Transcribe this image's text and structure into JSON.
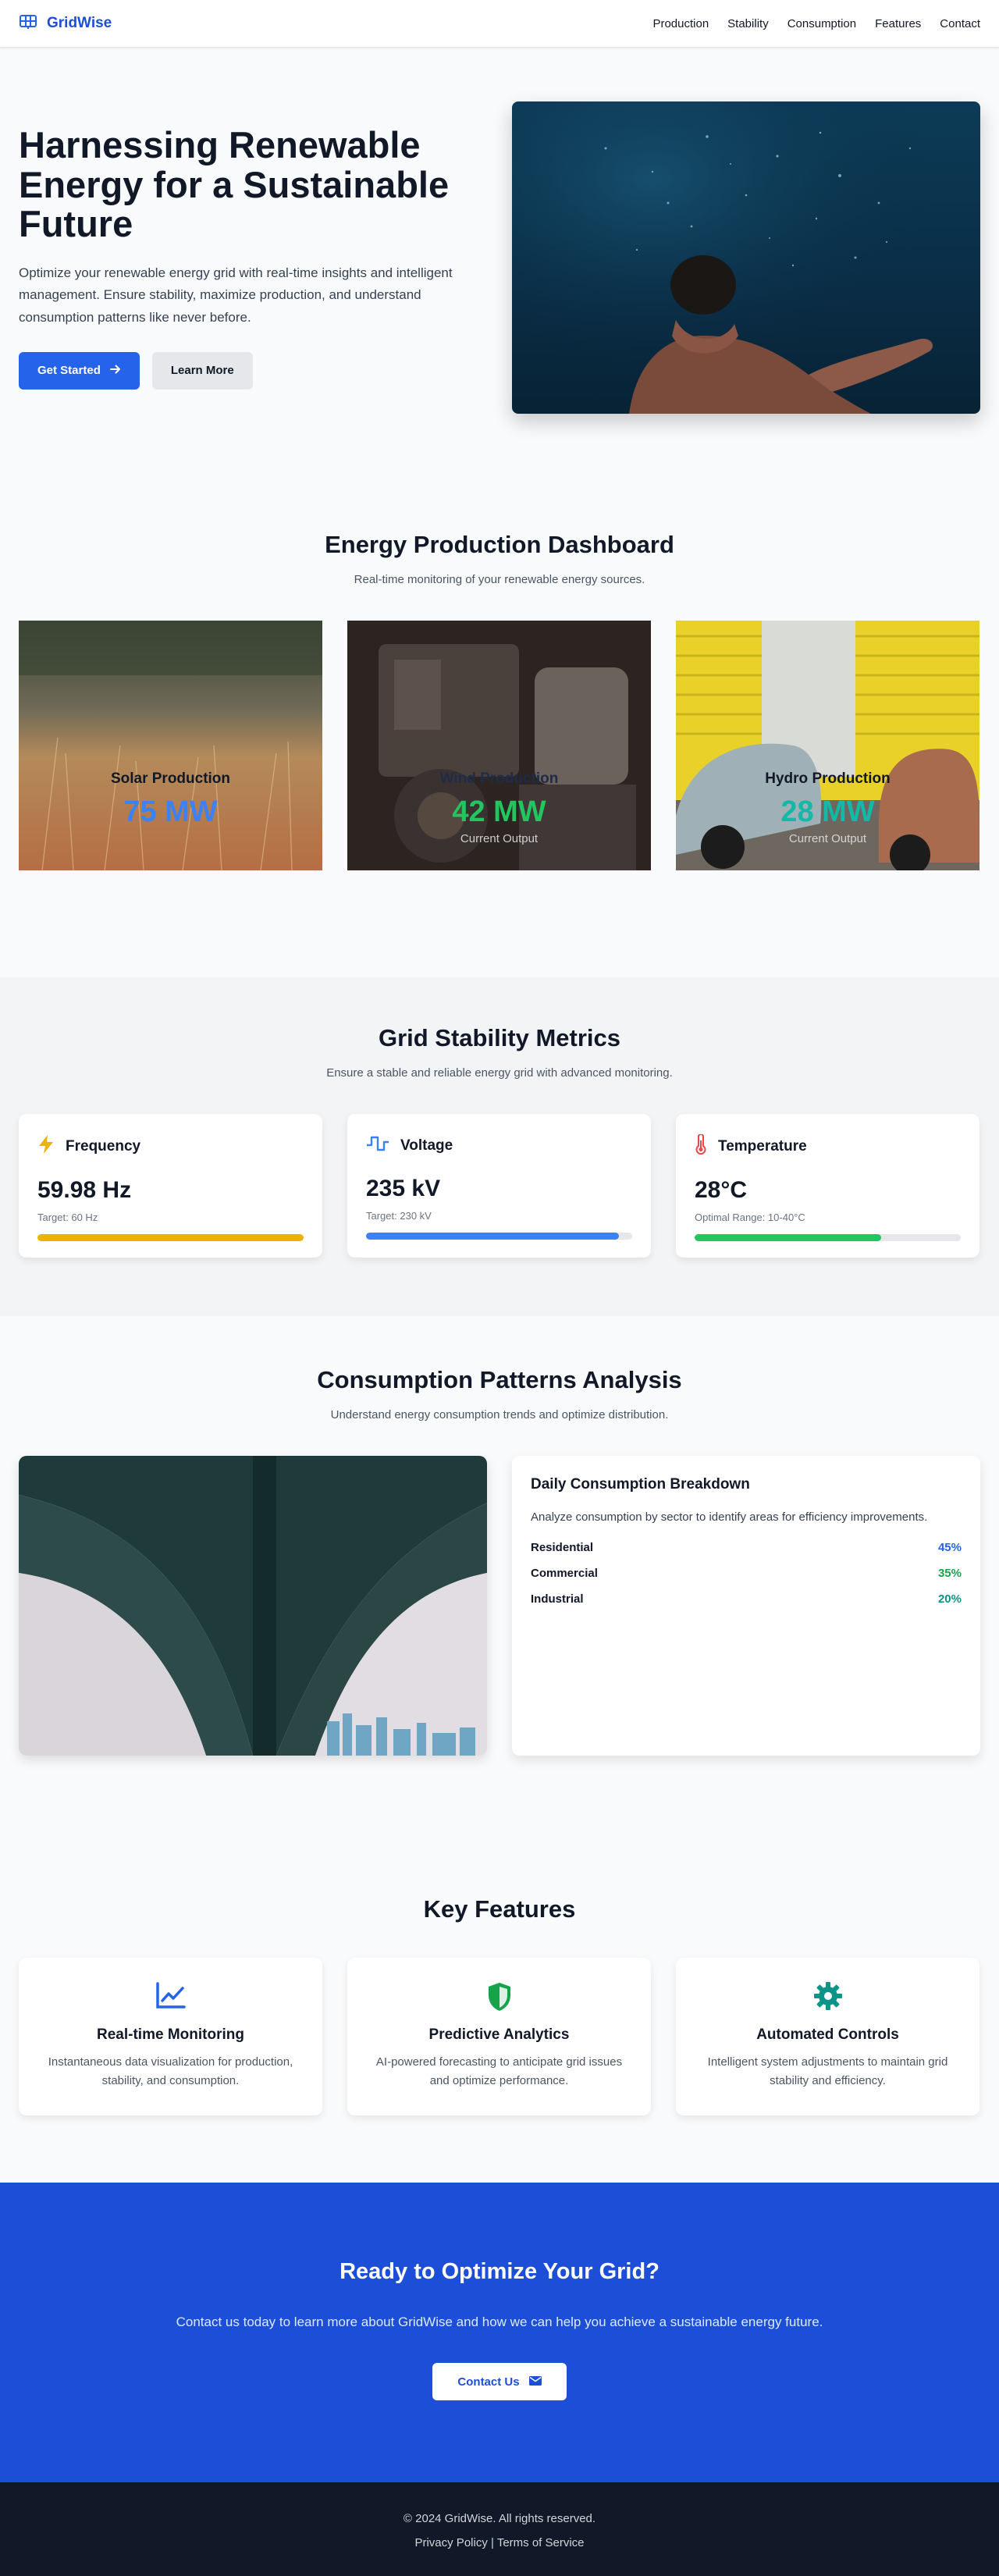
{
  "header": {
    "brand": "GridWise",
    "nav": [
      "Production",
      "Stability",
      "Consumption",
      "Features",
      "Contact"
    ]
  },
  "hero": {
    "title": "Harnessing Renewable Energy for a Sustainable Future",
    "subtitle": "Optimize your renewable energy grid with real-time insights and intelligent management. Ensure stability, maximize production, and understand consumption patterns like never before.",
    "primary_button": "Get Started",
    "secondary_button": "Learn More"
  },
  "dashboard": {
    "title": "Energy Production Dashboard",
    "subtitle": "Real-time monitoring of your renewable energy sources.",
    "cards": [
      {
        "name": "Solar Production",
        "value": "75 MW",
        "label": "",
        "value_color": "#3b82f6"
      },
      {
        "name": "Wind Production",
        "value": "42 MW",
        "label": "Current Output",
        "value_color": "#22c55e"
      },
      {
        "name": "Hydro Production",
        "value": "28 MW",
        "label": "Current Output",
        "value_color": "#14b8a6"
      }
    ]
  },
  "stability": {
    "title": "Grid Stability Metrics",
    "subtitle": "Ensure a stable and reliable energy grid with advanced monitoring.",
    "cards": [
      {
        "name": "Frequency",
        "icon": "lightning-icon",
        "value": "59.98 Hz",
        "target": "Target: 60 Hz",
        "fill_fraction": 1.0,
        "color": "#eab308"
      },
      {
        "name": "Voltage",
        "icon": "pulse-icon",
        "value": "235 kV",
        "target": "Target: 230 kV",
        "fill_fraction": 0.95,
        "color": "#3b82f6"
      },
      {
        "name": "Temperature",
        "icon": "thermometer-icon",
        "value": "28°C",
        "target": "Optimal Range: 10-40°C",
        "fill_fraction": 0.7,
        "color": "#22c55e"
      }
    ]
  },
  "consumption": {
    "title": "Consumption Patterns Analysis",
    "subtitle": "Understand energy consumption trends and optimize distribution.",
    "card_title": "Daily Consumption Breakdown",
    "card_desc": "Analyze consumption by sector to identify areas for efficiency improvements.",
    "rows": [
      {
        "sector": "Residential",
        "share": "45%",
        "color": "#2563eb"
      },
      {
        "sector": "Commercial",
        "share": "35%",
        "color": "#16a34a"
      },
      {
        "sector": "Industrial",
        "share": "20%",
        "color": "#0d9488"
      }
    ]
  },
  "features": {
    "title": "Key Features",
    "items": [
      {
        "icon": "chart-line-icon",
        "title": "Real-time Monitoring",
        "desc": "Instantaneous data visualization for production, stability, and consumption.",
        "color": "#2563eb"
      },
      {
        "icon": "shield-icon",
        "title": "Predictive Analytics",
        "desc": "AI-powered forecasting to anticipate grid issues and optimize performance.",
        "color": "#16a34a"
      },
      {
        "icon": "gear-icon",
        "title": "Automated Controls",
        "desc": "Intelligent system adjustments to maintain grid stability and efficiency.",
        "color": "#0d9488"
      }
    ]
  },
  "cta": {
    "title": "Ready to Optimize Your Grid?",
    "subtitle": "Contact us today to learn more about GridWise and how we can help you achieve a sustainable energy future.",
    "button": "Contact Us"
  },
  "footer": {
    "copyright": "© 2024 GridWise. All rights reserved.",
    "privacy": "Privacy Policy",
    "separator": "|",
    "terms": "Terms of Service"
  }
}
